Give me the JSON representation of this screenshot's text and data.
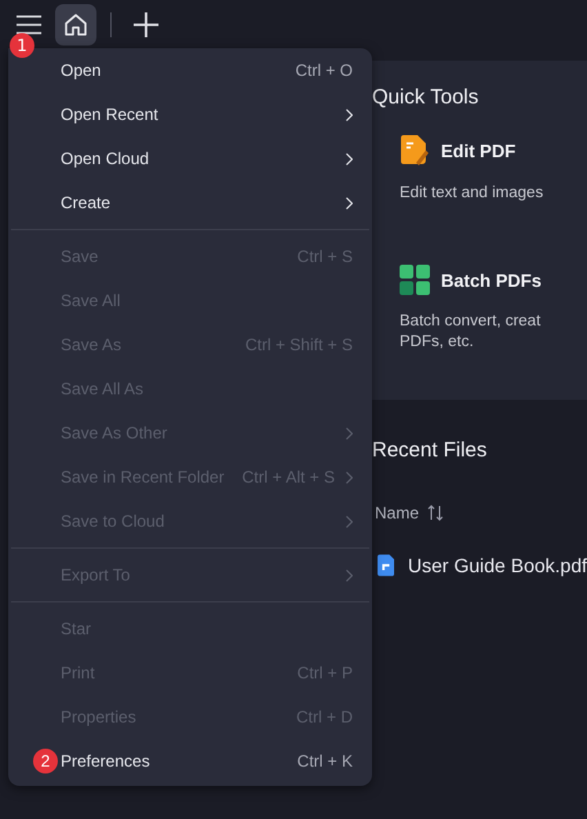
{
  "toolbar": {
    "menu_badge": "1"
  },
  "menu": {
    "sections": [
      [
        {
          "label": "Open",
          "shortcut": "Ctrl + O",
          "submenu": false,
          "disabled": false
        },
        {
          "label": "Open Recent",
          "submenu": true,
          "disabled": false
        },
        {
          "label": "Open Cloud",
          "submenu": true,
          "disabled": false
        },
        {
          "label": "Create",
          "submenu": true,
          "disabled": false
        }
      ],
      [
        {
          "label": "Save",
          "shortcut": "Ctrl + S",
          "submenu": false,
          "disabled": true
        },
        {
          "label": "Save All",
          "submenu": false,
          "disabled": true
        },
        {
          "label": "Save As",
          "shortcut": "Ctrl + Shift + S",
          "submenu": false,
          "disabled": true
        },
        {
          "label": "Save All As",
          "submenu": false,
          "disabled": true
        },
        {
          "label": "Save As Other",
          "submenu": true,
          "disabled": true
        },
        {
          "label": "Save in Recent Folder",
          "shortcut": "Ctrl + Alt + S",
          "submenu": true,
          "disabled": true
        },
        {
          "label": "Save to Cloud",
          "submenu": true,
          "disabled": true
        }
      ],
      [
        {
          "label": "Export To",
          "submenu": true,
          "disabled": true
        }
      ],
      [
        {
          "label": "Star",
          "submenu": false,
          "disabled": true
        },
        {
          "label": "Print",
          "shortcut": "Ctrl + P",
          "submenu": false,
          "disabled": true
        },
        {
          "label": "Properties",
          "shortcut": "Ctrl + D",
          "submenu": false,
          "disabled": true
        },
        {
          "label": "Preferences",
          "shortcut": "Ctrl + K",
          "submenu": false,
          "disabled": false,
          "badge": "2"
        }
      ]
    ]
  },
  "quick_tools": {
    "title": "Quick Tools",
    "tools": [
      {
        "kind": "edit",
        "name": "Edit PDF",
        "description": "Edit text and images"
      },
      {
        "kind": "batch",
        "name": "Batch PDFs",
        "description": "Batch convert, creat PDFs, etc."
      }
    ]
  },
  "recent_files": {
    "title": "Recent Files",
    "column": "Name",
    "files": [
      {
        "name": "User Guide Book.pdf"
      }
    ]
  }
}
